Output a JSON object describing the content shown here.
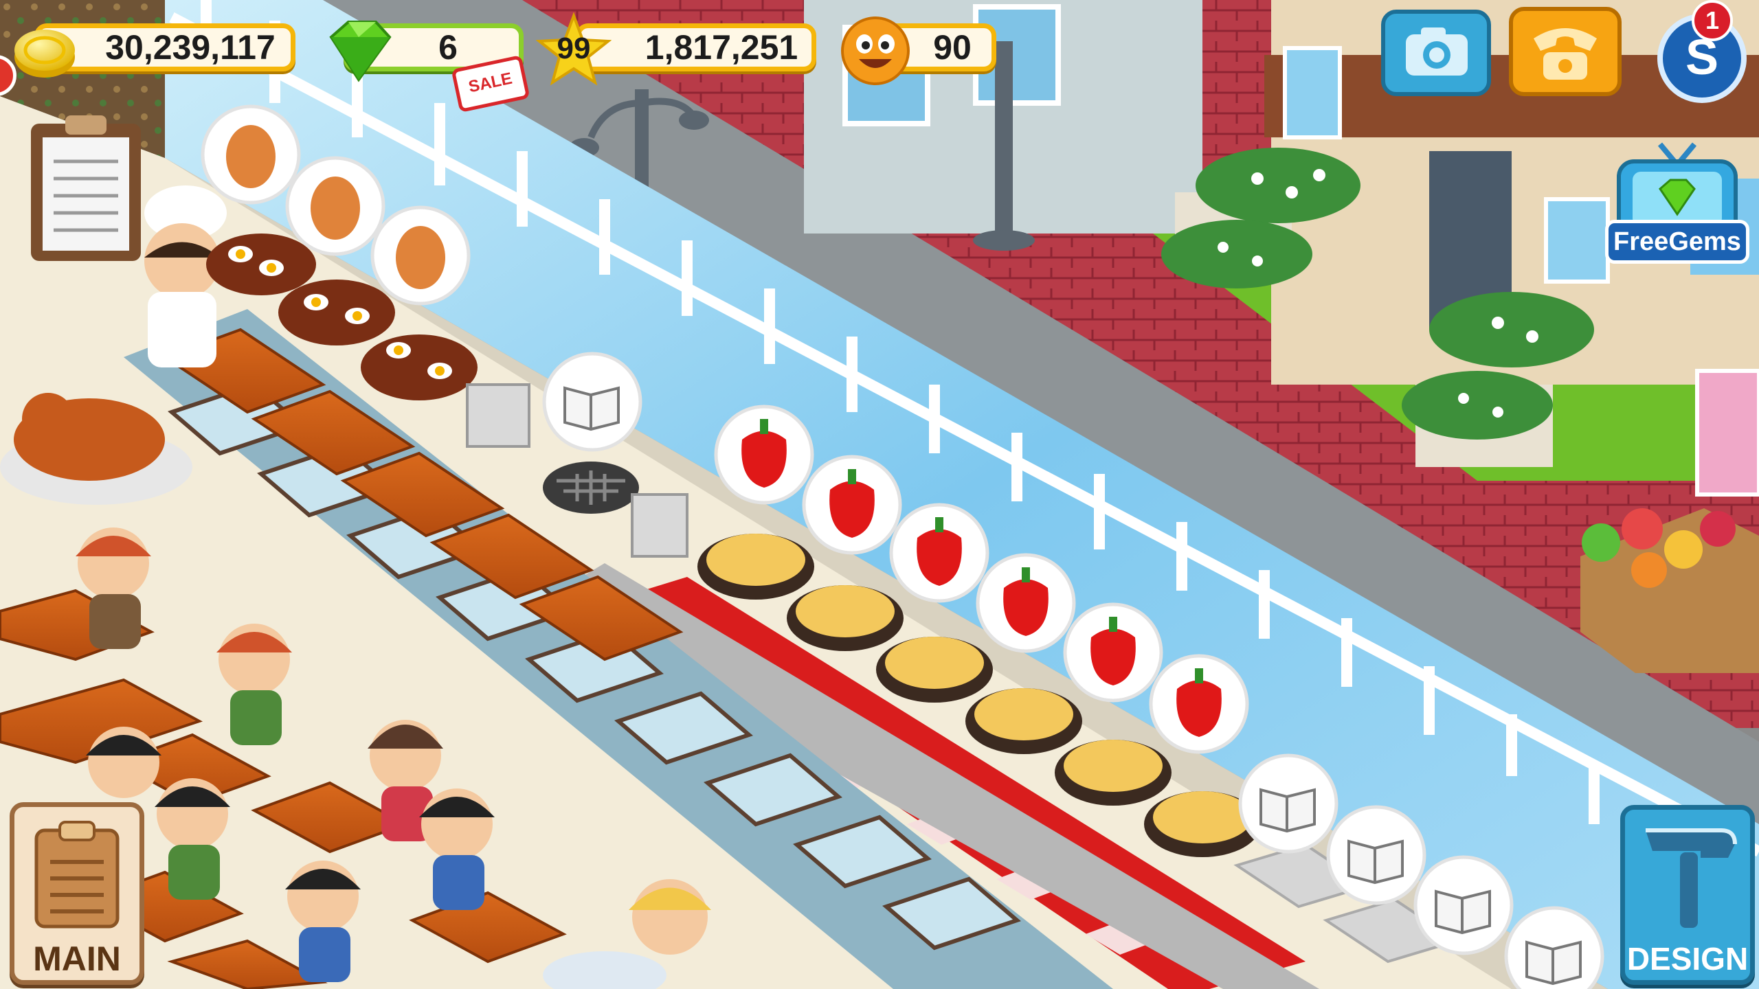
{
  "hud": {
    "coins": "30,239,117",
    "gems": "6",
    "sale_badge": "SALE",
    "level": "99",
    "experience": "1,817,251",
    "happiness": "90",
    "notification_count": "1",
    "free_gems_label": "FreeGems"
  },
  "buttons": {
    "main_label": "MAIN",
    "design_label": "DESIGN"
  },
  "icons": {
    "coin": "coin-icon",
    "gem": "gem-icon",
    "star": "star-icon",
    "smiley": "smiley-icon",
    "camera": "camera-icon",
    "phone": "phone-icon",
    "social": "social-icon",
    "clipboard": "clipboard-icon",
    "hammer": "hammer-icon",
    "egg": "egg-icon",
    "pepper": "pepper-icon",
    "recipe_book": "recipe-book-icon"
  },
  "colors": {
    "hud_border": "#f5b60a",
    "gem_pill_border": "#8ccf2c",
    "button_blue": "#37a8d8",
    "phone_orange": "#f7a412",
    "red_carpet": "#d91d1d"
  }
}
